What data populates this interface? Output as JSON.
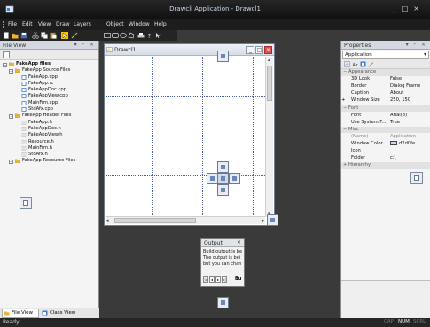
{
  "window": {
    "title": "Drawcli Application - Drawcl1",
    "controls": [
      "_",
      "□",
      "×"
    ]
  },
  "menubar": {
    "items": [
      "File",
      "Edit",
      "View",
      "Draw",
      "Layers",
      "Object",
      "Window",
      "Help"
    ]
  },
  "toolbar": {
    "icons": [
      "new-icon",
      "open-icon",
      "save-icon",
      "cut-icon",
      "copy-icon",
      "paste-icon",
      "select-icon",
      "line-icon",
      "rectangle-icon",
      "round-rect-icon",
      "ellipse-icon",
      "polygon-icon",
      "print-icon",
      "about-icon",
      "help-pointer-icon"
    ]
  },
  "file_view": {
    "title": "File View",
    "controls": "▾ ᵖ ×",
    "tree": [
      {
        "label": "FakeApp files",
        "level": 0,
        "bold": true,
        "icon": "folder"
      },
      {
        "label": "FakeApp Source Files",
        "level": 1,
        "icon": "folder"
      },
      {
        "label": "FakeApp.cpp",
        "level": 2,
        "icon": "cpp-file"
      },
      {
        "label": "FakeApp.rc",
        "level": 2,
        "icon": "cpp-file"
      },
      {
        "label": "FakeAppDoc.cpp",
        "level": 2,
        "icon": "cpp-file"
      },
      {
        "label": "FakeAppView.cpp",
        "level": 2,
        "icon": "cpp-file"
      },
      {
        "label": "MainFrm.cpp",
        "level": 2,
        "icon": "cpp-file"
      },
      {
        "label": "StdAfx.cpp",
        "level": 2,
        "icon": "cpp-file"
      },
      {
        "label": "FakeApp Header Files",
        "level": 1,
        "icon": "folder"
      },
      {
        "label": "FakeApp.h",
        "level": 2,
        "icon": "h-file"
      },
      {
        "label": "FakeAppDoc.h",
        "level": 2,
        "icon": "h-file"
      },
      {
        "label": "FakeAppView.h",
        "level": 2,
        "icon": "h-file"
      },
      {
        "label": "Resource.h",
        "level": 2,
        "icon": "h-file"
      },
      {
        "label": "MainFrm.h",
        "level": 2,
        "icon": "h-file"
      },
      {
        "label": "StdAfx.h",
        "level": 2,
        "icon": "h-file"
      },
      {
        "label": "FakeApp Resource Files",
        "level": 1,
        "icon": "folder"
      }
    ],
    "tabs": [
      "File View",
      "Class View"
    ]
  },
  "document": {
    "title": "Drawcl1"
  },
  "output": {
    "title": "Output",
    "close": "×",
    "lines": [
      "Build output is bei",
      "The output is bei",
      "but you can chan"
    ],
    "nav": [
      "|◂",
      "◂",
      "▸",
      "▸|"
    ],
    "active_tab": "Bu"
  },
  "properties": {
    "title": "Properties",
    "controls": "▾ ᵖ ×",
    "object_combo": "Application",
    "rows": [
      {
        "type": "category",
        "name": "Appearance",
        "sign": "−"
      },
      {
        "name": "3D Look",
        "value": "False"
      },
      {
        "name": "Border",
        "value": "Dialog Frame"
      },
      {
        "name": "Caption",
        "value": "About"
      },
      {
        "name": "Window Size",
        "value": "250, 150",
        "sign": "+"
      },
      {
        "type": "category",
        "name": "Font",
        "sign": "−"
      },
      {
        "name": "Font",
        "value": "Arial(8)"
      },
      {
        "name": "Use System F...",
        "value": "True"
      },
      {
        "type": "category",
        "name": "Misc",
        "sign": "−"
      },
      {
        "name": "(Name)",
        "value": "Application",
        "gray": true
      },
      {
        "name": "Window Color",
        "value": "d2d0fe",
        "swatch": "#d2d0fe"
      },
      {
        "name": "Icon",
        "value": ""
      },
      {
        "name": "Folder",
        "value": "c:\\"
      },
      {
        "type": "category",
        "name": "Hierarchy",
        "sign": "+"
      }
    ]
  },
  "statusbar": {
    "text": "Ready",
    "indicators": [
      {
        "label": "CAP",
        "on": false
      },
      {
        "label": "NUM",
        "on": true
      },
      {
        "label": "SCRL",
        "on": false
      }
    ]
  },
  "colors": {
    "accent": "#ffc400",
    "folder": "#e8b73a",
    "file": "#3f7fd1",
    "mdi_background": "#3a3a3a",
    "titlebar": "#1a1a1a"
  }
}
